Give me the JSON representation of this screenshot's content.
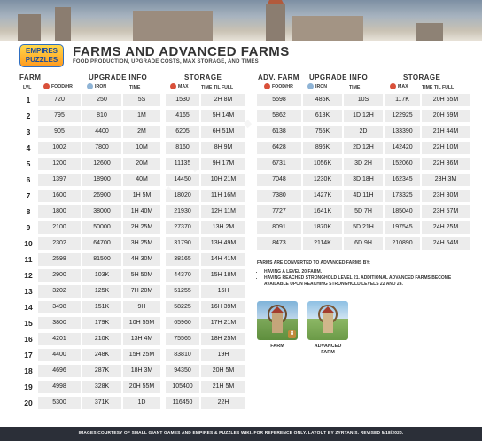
{
  "header": {
    "logo_line1": "EMPIRES",
    "logo_line2": "PUZZLES",
    "title": "FARMS AND ADVANCED FARMS",
    "subtitle": "FOOD PRODUCTION, UPGRADE COSTS, MAX STORAGE, AND TIMES"
  },
  "farm_table": {
    "title": "FARM",
    "upgrade_title": "UPGRADE INFO",
    "storage_title": "STORAGE",
    "col_lvl": "LVL",
    "col_food": "FOOD/HR",
    "col_iron": "IRON",
    "col_time": "TIME",
    "col_max": "MAX",
    "col_full": "TIME TIL FULL",
    "rows": [
      {
        "lvl": "1",
        "food": "720",
        "iron": "250",
        "time": "5S",
        "max": "1530",
        "full": "2H 8M"
      },
      {
        "lvl": "2",
        "food": "795",
        "iron": "810",
        "time": "1M",
        "max": "4165",
        "full": "5H 14M"
      },
      {
        "lvl": "3",
        "food": "905",
        "iron": "4400",
        "time": "2M",
        "max": "6205",
        "full": "6H 51M"
      },
      {
        "lvl": "4",
        "food": "1002",
        "iron": "7800",
        "time": "10M",
        "max": "8160",
        "full": "8H 9M"
      },
      {
        "lvl": "5",
        "food": "1200",
        "iron": "12600",
        "time": "20M",
        "max": "11135",
        "full": "9H 17M"
      },
      {
        "lvl": "6",
        "food": "1397",
        "iron": "18900",
        "time": "40M",
        "max": "14450",
        "full": "10H 21M"
      },
      {
        "lvl": "7",
        "food": "1600",
        "iron": "26900",
        "time": "1H 5M",
        "max": "18020",
        "full": "11H 16M"
      },
      {
        "lvl": "8",
        "food": "1800",
        "iron": "38000",
        "time": "1H 40M",
        "max": "21930",
        "full": "12H 11M"
      },
      {
        "lvl": "9",
        "food": "2100",
        "iron": "50000",
        "time": "2H 25M",
        "max": "27370",
        "full": "13H 2M"
      },
      {
        "lvl": "10",
        "food": "2302",
        "iron": "64700",
        "time": "3H 25M",
        "max": "31790",
        "full": "13H 49M"
      },
      {
        "lvl": "11",
        "food": "2598",
        "iron": "81500",
        "time": "4H 30M",
        "max": "38165",
        "full": "14H 41M"
      },
      {
        "lvl": "12",
        "food": "2900",
        "iron": "103K",
        "time": "5H 50M",
        "max": "44370",
        "full": "15H 18M"
      },
      {
        "lvl": "13",
        "food": "3202",
        "iron": "125K",
        "time": "7H 20M",
        "max": "51255",
        "full": "16H"
      },
      {
        "lvl": "14",
        "food": "3498",
        "iron": "151K",
        "time": "9H",
        "max": "58225",
        "full": "16H 39M"
      },
      {
        "lvl": "15",
        "food": "3800",
        "iron": "179K",
        "time": "10H 55M",
        "max": "65960",
        "full": "17H 21M"
      },
      {
        "lvl": "16",
        "food": "4201",
        "iron": "210K",
        "time": "13H 4M",
        "max": "75565",
        "full": "18H 25M"
      },
      {
        "lvl": "17",
        "food": "4400",
        "iron": "248K",
        "time": "15H 25M",
        "max": "83810",
        "full": "19H"
      },
      {
        "lvl": "18",
        "food": "4696",
        "iron": "287K",
        "time": "18H 3M",
        "max": "94350",
        "full": "20H 5M"
      },
      {
        "lvl": "19",
        "food": "4998",
        "iron": "328K",
        "time": "20H 55M",
        "max": "105400",
        "full": "21H 5M"
      },
      {
        "lvl": "20",
        "food": "5300",
        "iron": "371K",
        "time": "1D",
        "max": "116450",
        "full": "22H"
      }
    ]
  },
  "adv_table": {
    "title": "ADV. FARM",
    "upgrade_title": "UPGRADE INFO",
    "storage_title": "STORAGE",
    "col_food": "FOOD/HR",
    "col_iron": "IRON",
    "col_time": "TIME",
    "col_max": "MAX",
    "col_full": "TIME TIL FULL",
    "rows": [
      {
        "food": "5598",
        "iron": "486K",
        "time": "10S",
        "max": "117K",
        "full": "20H 55M"
      },
      {
        "food": "5862",
        "iron": "618K",
        "time": "1D 12H",
        "max": "122925",
        "full": "20H 59M"
      },
      {
        "food": "6138",
        "iron": "755K",
        "time": "2D",
        "max": "133390",
        "full": "21H 44M"
      },
      {
        "food": "6428",
        "iron": "896K",
        "time": "2D 12H",
        "max": "142420",
        "full": "22H 10M"
      },
      {
        "food": "6731",
        "iron": "1056K",
        "time": "3D 2H",
        "max": "152060",
        "full": "22H 36M"
      },
      {
        "food": "7048",
        "iron": "1230K",
        "time": "3D 18H",
        "max": "162345",
        "full": "23H 3M"
      },
      {
        "food": "7380",
        "iron": "1427K",
        "time": "4D 11H",
        "max": "173325",
        "full": "23H 30M"
      },
      {
        "food": "7727",
        "iron": "1641K",
        "time": "5D 7H",
        "max": "185040",
        "full": "23H 57M"
      },
      {
        "food": "8091",
        "iron": "1870K",
        "time": "5D 21H",
        "max": "197545",
        "full": "24H 25M"
      },
      {
        "food": "8473",
        "iron": "2114K",
        "time": "6D 9H",
        "max": "210890",
        "full": "24H 54M"
      }
    ]
  },
  "notes": {
    "heading": "FARMS ARE CONVERTED TO ADVANCED FARMS BY:",
    "items": [
      "HAVING A LEVEL 20 FARM.",
      "HAVING REACHED STRONGHOLD LEVEL 21. ADDITIONAL ADVANCED FARMS BECOME AVAILABLE UPON REACHING STRONGHOLD LEVELS 22 AND 24."
    ],
    "farm_caption": "FARM",
    "farm_badge": "8",
    "adv_caption_1": "ADVANCED",
    "adv_caption_2": "FARM"
  },
  "footer": {
    "text": "IMAGES COURTESY OF SMALL GIANT GAMES AND EMPIRES & PUZZLES WIKI. FOR REFERENCE ONLY. LAYOUT BY ZYRTANIS. REVISED 5/18/2020."
  },
  "colors": {
    "cell_bg": "#ececec",
    "food_icon": "#d9503a",
    "iron_icon": "#8fb4d6",
    "footer_bg": "#2b2f38"
  }
}
